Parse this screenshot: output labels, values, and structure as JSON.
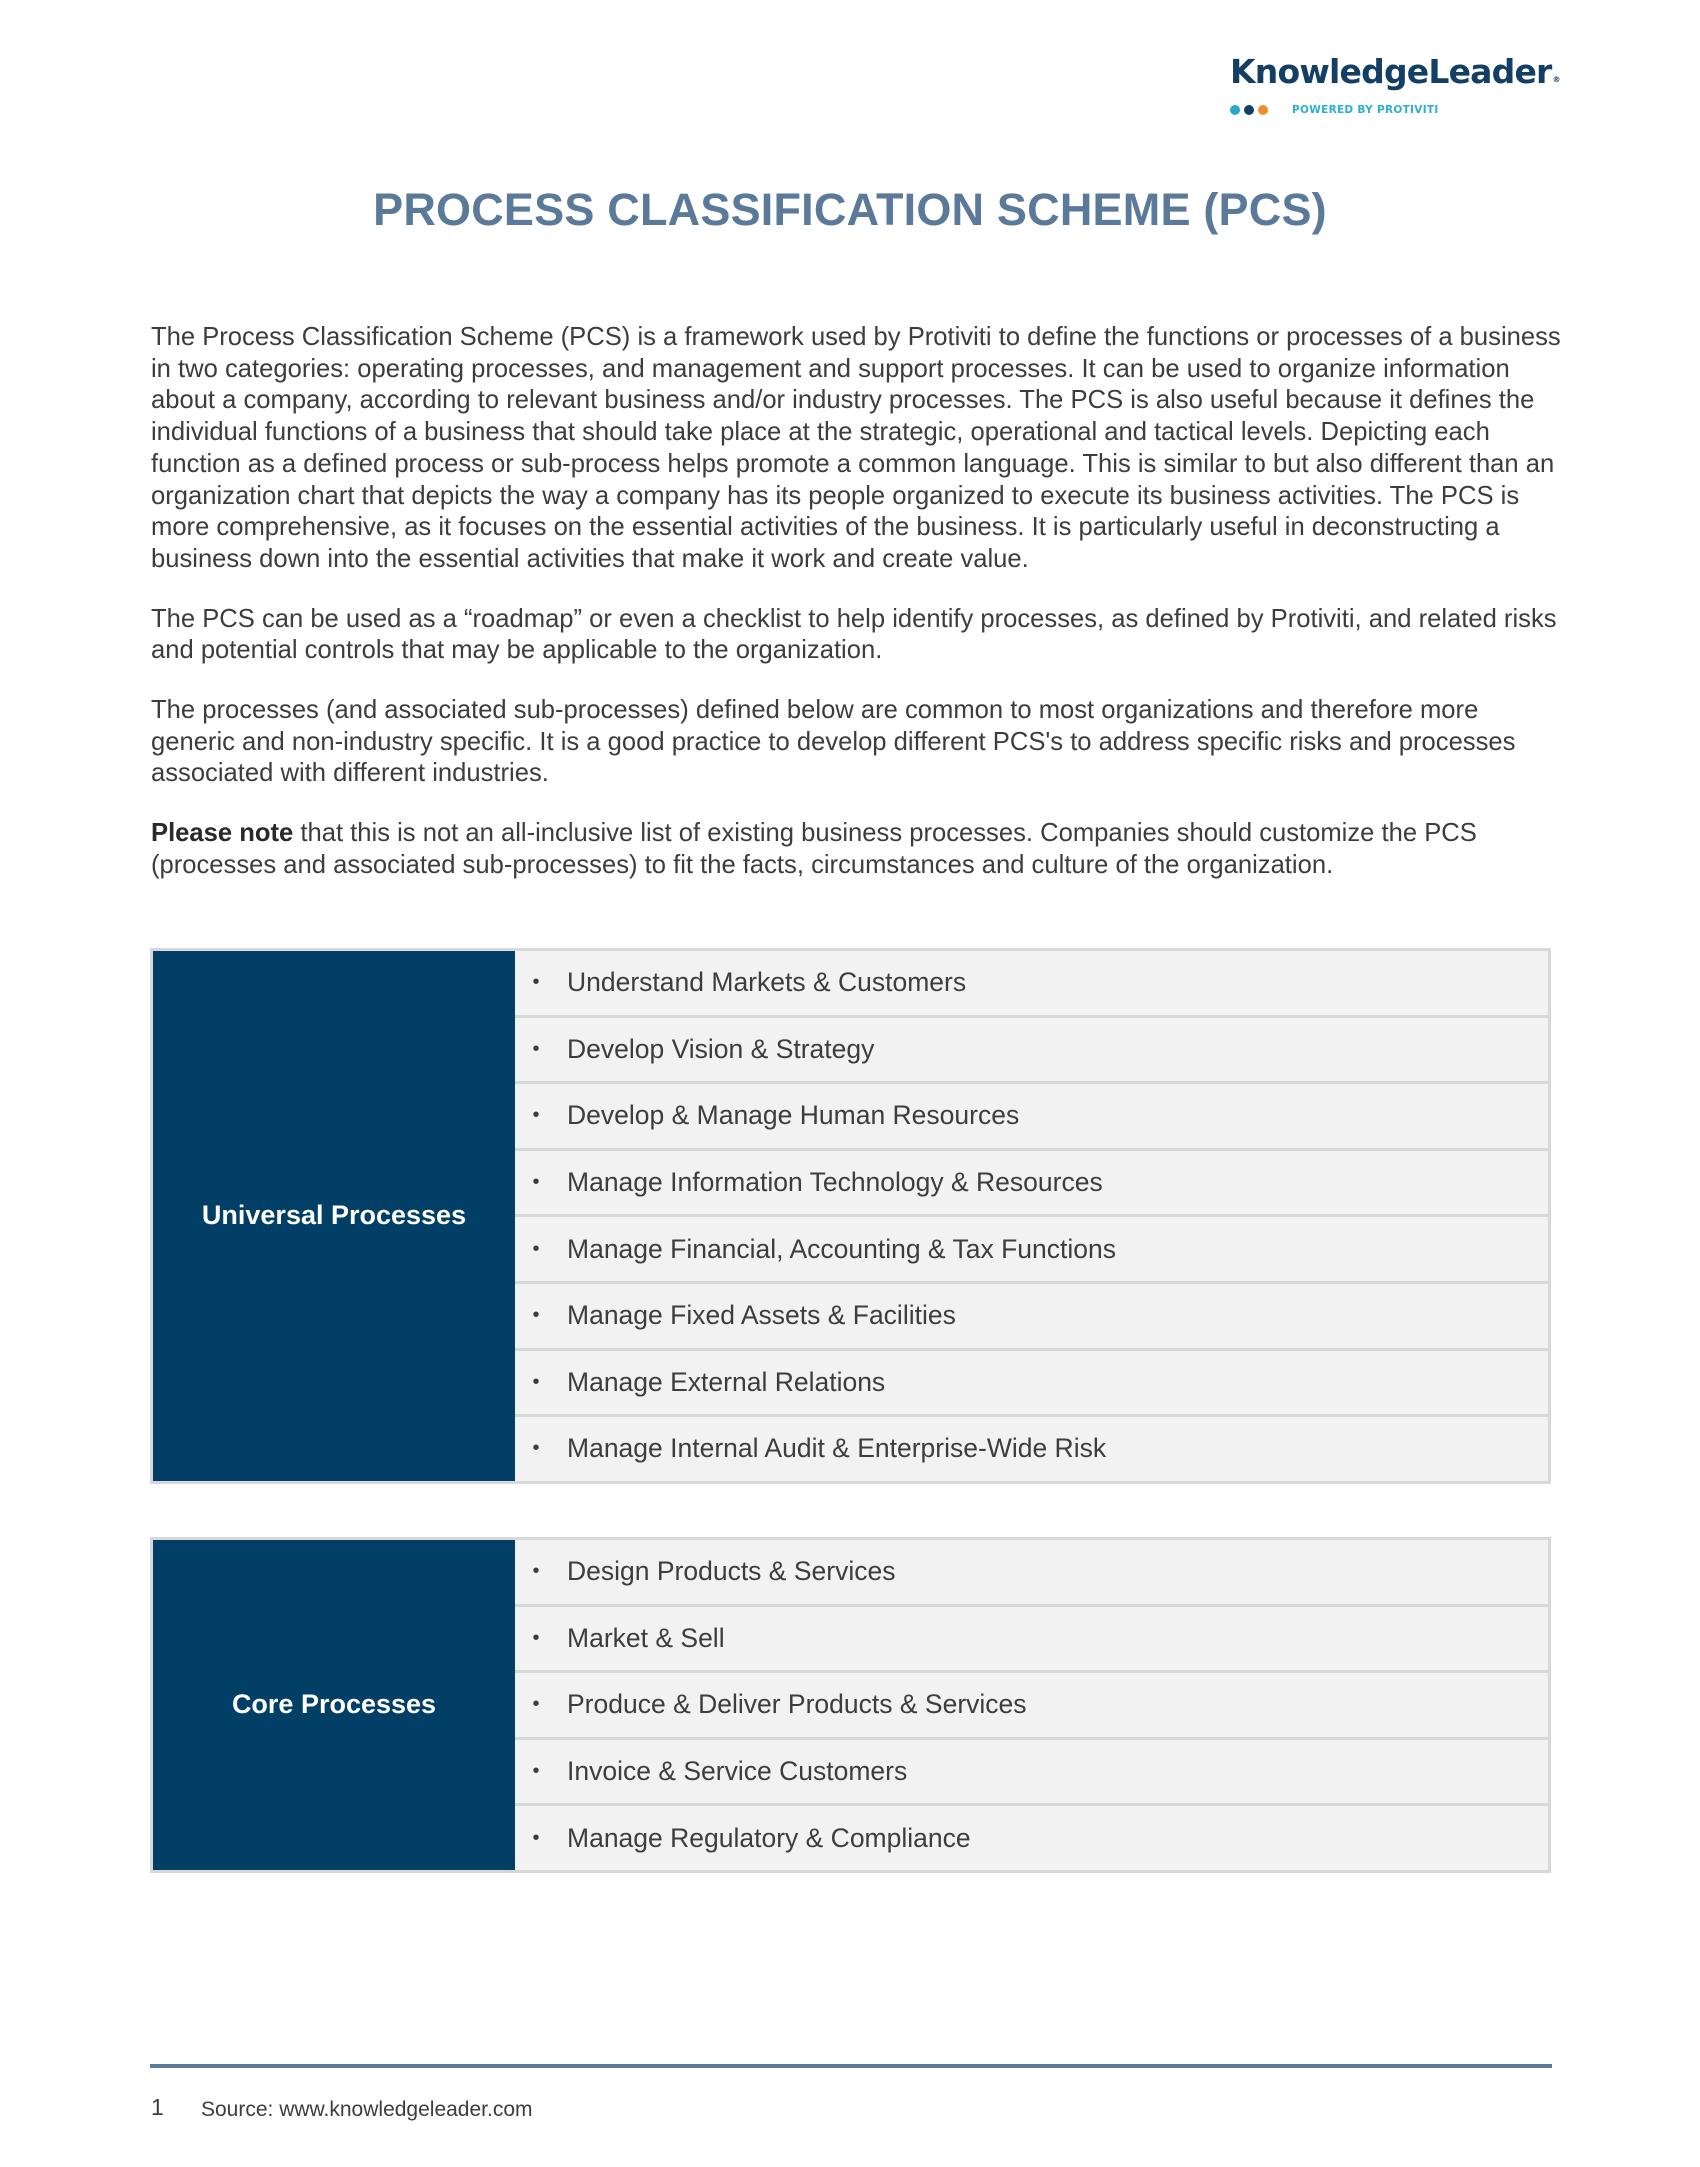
{
  "logo": {
    "wordmark": "KnowledgeLeader",
    "registered": "®",
    "tagline": "POWERED BY PROTIVITI",
    "dot_colors": [
      "#27a9cc",
      "#123f63",
      "#f28b2b"
    ]
  },
  "title": "PROCESS CLASSIFICATION SCHEME (PCS)",
  "paragraphs": [
    "The Process Classification Scheme (PCS) is a framework used by Protiviti to define the functions or processes of a business in two categories: operating processes, and management and support processes. It can be used to organize information about a company, according to relevant business and/or industry processes. The PCS is also useful because it defines the individual functions of a business that should take place at the strategic, operational and tactical levels. Depicting each function as a defined process or sub-process helps promote a common language. This is similar to but also different than an organization chart that depicts the way a company has its people organized to execute its business activities. The PCS is more comprehensive, as it focuses on the essential activities of the business. It is particularly useful in deconstructing a business down into the essential activities that make it work and create value.",
    "The PCS can be used as a “roadmap” or even a checklist to help identify processes, as defined by Protiviti, and related risks and potential controls that may be applicable to the organization.",
    "The processes (and associated sub-processes) defined below are common to most organizations and therefore more generic and non-industry specific. It is a good practice to develop different PCS's to address specific risks and processes associated with different industries."
  ],
  "note": {
    "bold": "Please note",
    "rest": " that this is not an all-inclusive list of existing business processes. Companies should customize the PCS (processes and associated sub-processes) to fit the facts, circumstances and culture of the organization."
  },
  "tables": [
    {
      "label": "Universal Processes",
      "items": [
        "Understand Markets & Customers",
        "Develop Vision & Strategy",
        "Develop & Manage Human Resources",
        "Manage Information Technology & Resources",
        "Manage Financial, Accounting & Tax Functions",
        "Manage Fixed Assets & Facilities",
        "Manage External Relations",
        "Manage Internal Audit & Enterprise-Wide Risk"
      ]
    },
    {
      "label": "Core Processes",
      "items": [
        "Design Products & Services",
        "Market & Sell",
        "Produce & Deliver Products & Services",
        "Invoice & Service Customers",
        "Manage Regulatory & Compliance"
      ]
    }
  ],
  "bullet_glyph": "•",
  "footer": {
    "page_number": "1",
    "source": "Source: www.knowledgeleader.com"
  },
  "colors": {
    "title": "#5b7a9a",
    "label_bg": "#023f66",
    "row_bg": "#f2f2f2",
    "footer_rule": "#5b7a99"
  }
}
